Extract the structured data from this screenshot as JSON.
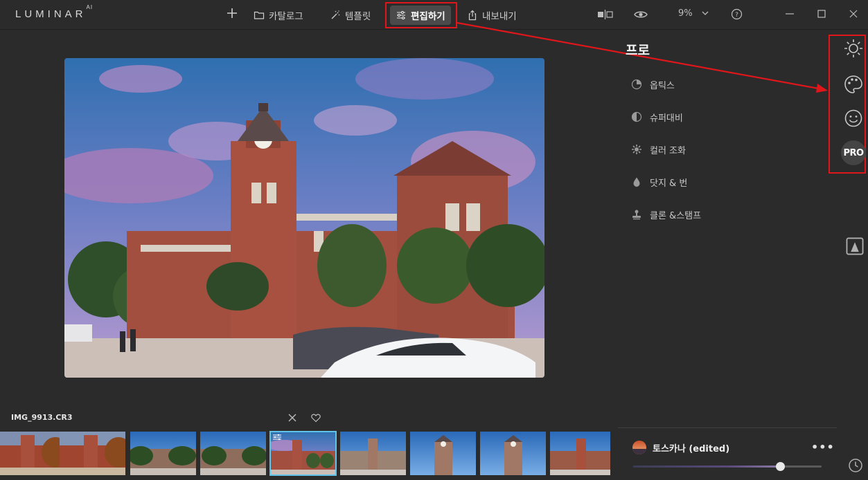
{
  "app": {
    "logo_text": "LUMINAR",
    "logo_sup": "AI"
  },
  "nav": {
    "add_icon": "plus-icon",
    "catalog_label": "카탈로그",
    "templates_label": "템플릿",
    "edit_label": "편집하기",
    "export_label": "내보내기"
  },
  "toolbar": {
    "zoom_value": "9%",
    "compare_icon": "compare-icon",
    "preview_icon": "eye-icon",
    "help_icon": "help-icon"
  },
  "panel": {
    "title": "프로",
    "tools": [
      {
        "label": "옵틱스",
        "icon": "optics-icon"
      },
      {
        "label": "슈퍼대비",
        "icon": "contrast-icon"
      },
      {
        "label": "컬러 조화",
        "icon": "color-harmony-icon"
      },
      {
        "label": "닷지 & 번",
        "icon": "drop-icon"
      },
      {
        "label": "클론 &스탬프",
        "icon": "stamp-icon"
      }
    ],
    "pro_badge": "PRO"
  },
  "filmstrip": {
    "filename": "IMG_9913.CR3"
  },
  "preset": {
    "name": "토스카나 (edited)",
    "more": "•••",
    "amount": 0.78
  },
  "colors": {
    "highlight": "#e0161b",
    "selection": "#61c3ea",
    "background": "#2b2b2b"
  }
}
